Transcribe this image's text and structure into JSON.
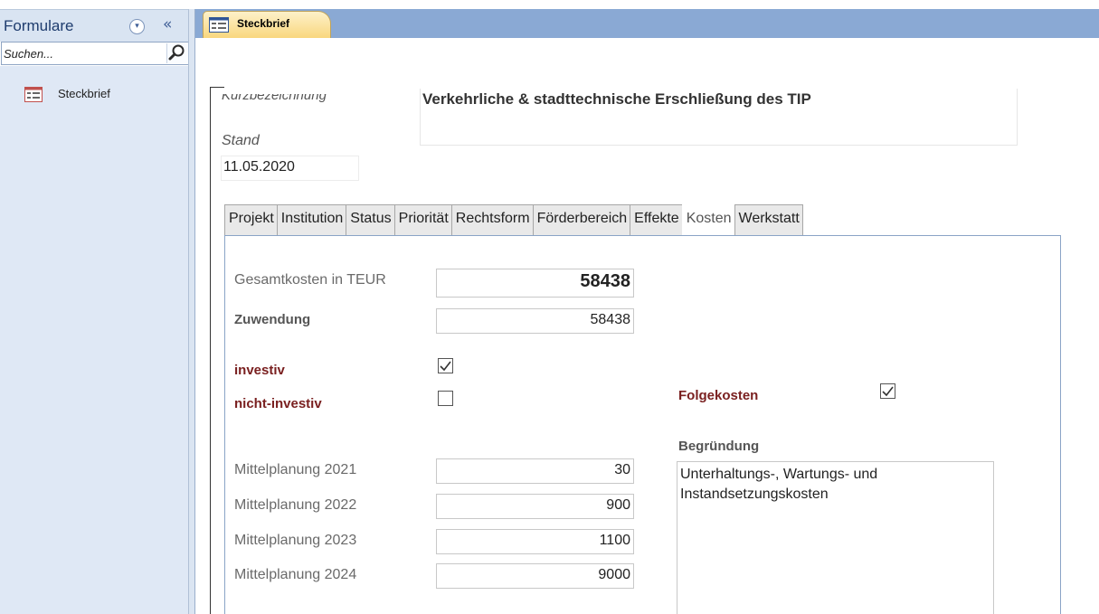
{
  "nav": {
    "title": "Formulare",
    "collapse_glyph": "«",
    "dropdown_glyph": "▾",
    "search_placeholder": "Suchen...",
    "items": [
      {
        "label": "Steckbrief",
        "icon": "form-icon"
      }
    ]
  },
  "document_tab": {
    "label": "Steckbrief",
    "icon": "form-icon"
  },
  "form": {
    "kurzbezeichnung_label": "Kurzbezeichnung",
    "title": "Verkehrliche & stadttechnische Erschließung des TIP",
    "stand_label": "Stand",
    "stand_value": "11.05.2020",
    "tabs": [
      {
        "label": "Projekt",
        "active": false
      },
      {
        "label": "Institution",
        "active": false
      },
      {
        "label": "Status",
        "active": false
      },
      {
        "label": "Priorität",
        "active": false
      },
      {
        "label": "Rechtsform",
        "active": false
      },
      {
        "label": "Förderbereich",
        "active": false
      },
      {
        "label": "Effekte",
        "active": false
      },
      {
        "label": "Kosten",
        "active": true
      },
      {
        "label": "Werkstatt",
        "active": false
      }
    ],
    "kosten": {
      "gesamtkosten_label": "Gesamtkosten in TEUR",
      "gesamtkosten_value": "58438",
      "zuwendung_label": "Zuwendung",
      "zuwendung_value": "58438",
      "investiv_label": "investiv",
      "investiv_checked": true,
      "nicht_investiv_label": "nicht-investiv",
      "nicht_investiv_checked": false,
      "folgekosten_label": "Folgekosten",
      "folgekosten_checked": true,
      "begruendung_label": "Begründung",
      "begruendung_value": "Unterhaltungs-, Wartungs- und Instandsetzungskosten",
      "mittelplanung": [
        {
          "label": "Mittelplanung 2021",
          "value": "30"
        },
        {
          "label": "Mittelplanung 2022",
          "value": "900"
        },
        {
          "label": "Mittelplanung 2023",
          "value": "1100"
        },
        {
          "label": "Mittelplanung 2024",
          "value": "9000"
        }
      ]
    }
  },
  "colors": {
    "nav_header": "#d9e4f2",
    "nav_list": "#dfe8f5",
    "doc_strip": "#8aa9d4",
    "doc_tab": "#f9d77e",
    "tab_panel_border": "#8aa4c6"
  }
}
